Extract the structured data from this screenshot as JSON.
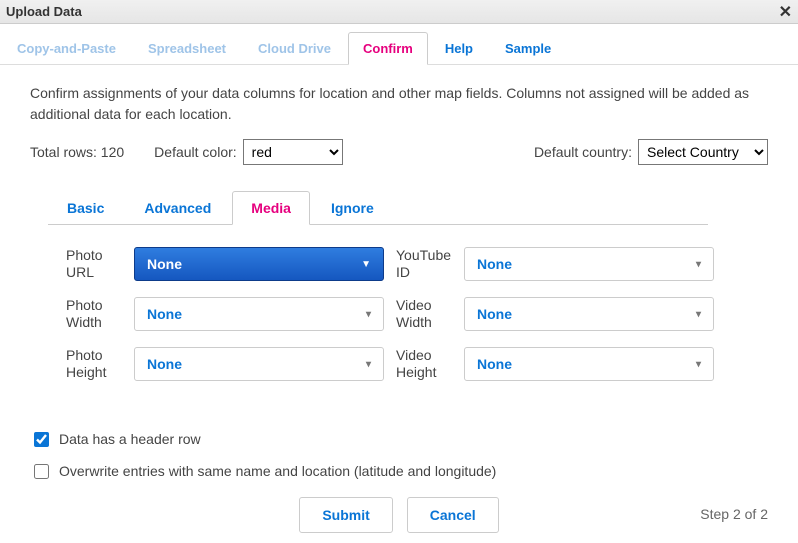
{
  "titlebar": {
    "title": "Upload Data"
  },
  "mainTabs": {
    "copyPaste": "Copy-and-Paste",
    "spreadsheet": "Spreadsheet",
    "cloudDrive": "Cloud Drive",
    "confirm": "Confirm",
    "help": "Help",
    "sample": "Sample"
  },
  "instruction": "Confirm assignments of your data columns for location and other map fields. Columns not assigned will be added as additional data for each location.",
  "totals": {
    "rowsLabel": "Total rows: 120",
    "defaultColorLabel": "Default color:",
    "defaultColorValue": "red",
    "defaultCountryLabel": "Default country:",
    "defaultCountryValue": "Select Country"
  },
  "subTabs": {
    "basic": "Basic",
    "advanced": "Advanced",
    "media": "Media",
    "ignore": "Ignore"
  },
  "fields": {
    "photoUrl": {
      "label": "Photo URL",
      "value": "None"
    },
    "photoWidth": {
      "label": "Photo Width",
      "value": "None"
    },
    "photoHeight": {
      "label": "Photo Height",
      "value": "None"
    },
    "youtubeId": {
      "label": "YouTube ID",
      "value": "None"
    },
    "videoWidth": {
      "label": "Video Width",
      "value": "None"
    },
    "videoHeight": {
      "label": "Video Height",
      "value": "None"
    }
  },
  "checkboxes": {
    "headerRow": "Data has a header row",
    "overwrite": "Overwrite entries with same name and location (latitude and longitude)"
  },
  "buttons": {
    "submit": "Submit",
    "cancel": "Cancel"
  },
  "footer": {
    "step": "Step 2 of 2"
  }
}
